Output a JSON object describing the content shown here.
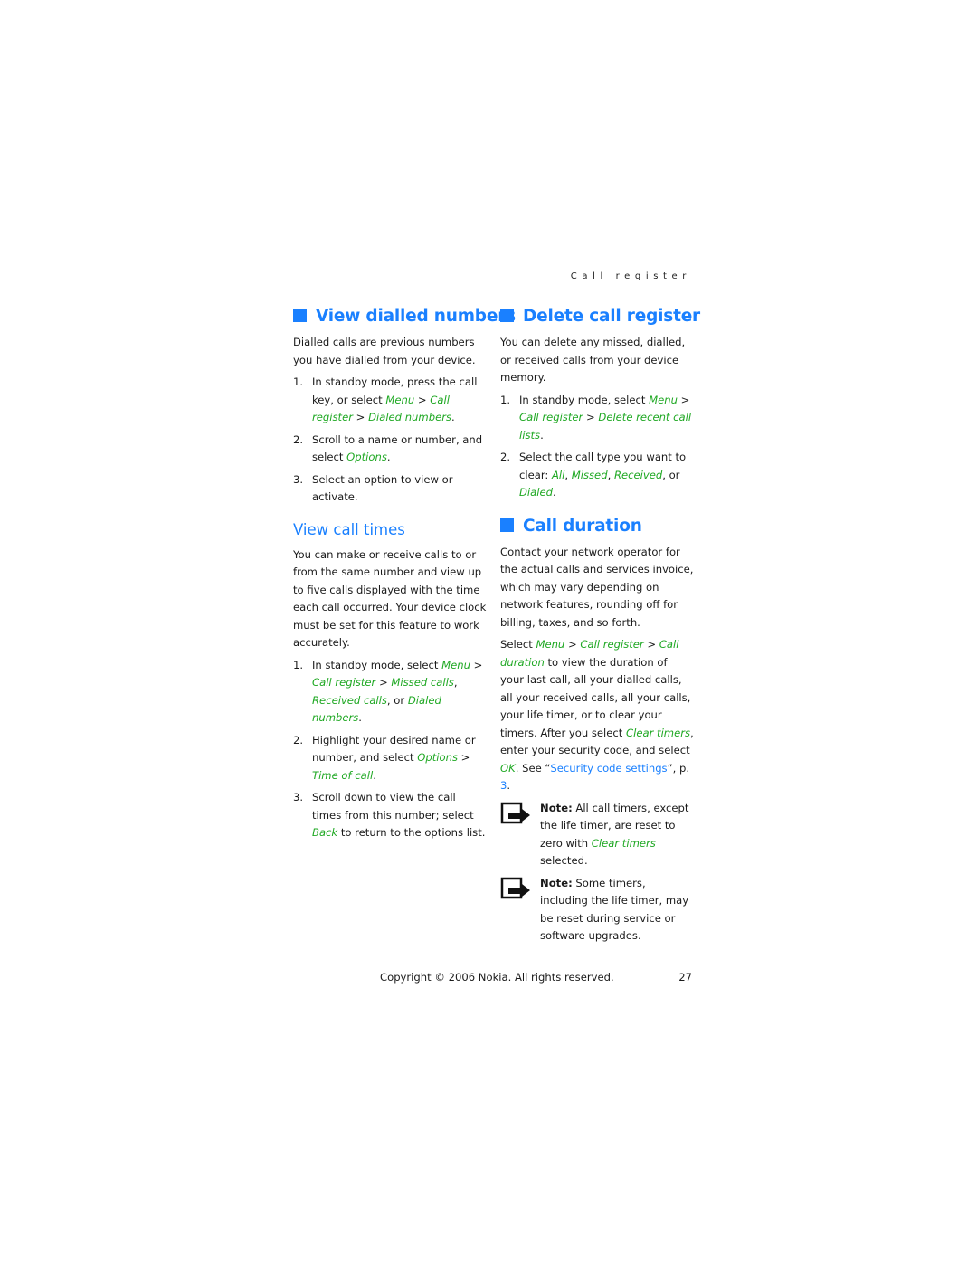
{
  "running_head": "Call register",
  "left_column": {
    "view_dialled": {
      "title": "View dialled numbers",
      "intro": "Dialled calls are previous numbers you have dialled from your device.",
      "steps": [
        {
          "num": "1.",
          "t1": "In standby mode, press the call key, or select ",
          "m1": "Menu",
          "s1": " > ",
          "m2": "Call register",
          "s2": " > ",
          "m3": "Dialed numbers",
          "end": "."
        },
        {
          "num": "2.",
          "t1": "Scroll to a name or number, and select ",
          "m1": "Options",
          "end": "."
        },
        {
          "num": "3.",
          "t1": "Select an option to view or activate."
        }
      ]
    },
    "view_call_times": {
      "title": "View call times",
      "intro": "You can make or receive calls to or from the same number and view up to five calls displayed with the time each call occurred. Your device clock must be set for this feature to work accurately.",
      "steps": [
        {
          "num": "1.",
          "t1": "In standby mode, select ",
          "m1": "Menu",
          "s1": " > ",
          "m2": "Call register",
          "s2": " > ",
          "m3": "Missed calls",
          "s3": ", ",
          "m4": "Received calls",
          "s4": ", or ",
          "m5": "Dialed numbers",
          "end": "."
        },
        {
          "num": "2.",
          "t1": "Highlight your desired name or number, and select ",
          "m1": "Options",
          "s1": " > ",
          "m2": "Time of call",
          "end": "."
        },
        {
          "num": "3.",
          "t1": "Scroll down to view the call times from this number; select ",
          "m1": "Back",
          "end": " to return to the options list."
        }
      ]
    }
  },
  "right_column": {
    "delete_register": {
      "title": "Delete call register",
      "intro": "You can delete any missed, dialled, or received calls from your device memory.",
      "steps": [
        {
          "num": "1.",
          "t1": "In standby mode, select ",
          "m1": "Menu",
          "s1": " > ",
          "m2": "Call register",
          "s2": " > ",
          "m3": "Delete recent call lists",
          "end": "."
        },
        {
          "num": "2.",
          "t1": "Select the call type you want to clear: ",
          "m1": "All",
          "s1": ", ",
          "m2": "Missed",
          "s2": ", ",
          "m3": "Received",
          "s3": ", or ",
          "m4": "Dialed",
          "end": "."
        }
      ]
    },
    "call_duration": {
      "title": "Call duration",
      "intro": "Contact your network operator for the actual calls and services invoice, which may vary depending on network features, rounding off for billing, taxes, and so forth.",
      "p2": {
        "t1": "Select ",
        "m1": "Menu",
        "s1": " > ",
        "m2": "Call register",
        "s2": " > ",
        "m3": "Call duration",
        "t2": " to view the duration of your last call, all your dialled calls, all your received calls, all your calls, your life timer, or to clear your timers. After you select ",
        "m4": "Clear timers",
        "t3": ", enter your security code, and select ",
        "m5": "OK",
        "t4": ". See “",
        "link": "Security code settings",
        "t5": "”, p. ",
        "page_link": "3",
        "t6": "."
      },
      "notes": [
        {
          "label": "Note:",
          "t1": " All call timers, except the life timer, are reset to zero with ",
          "m1": "Clear timers",
          "t2": " selected.",
          "icon": "note-icon"
        },
        {
          "label": "Note:",
          "t1": " Some timers, including the life timer, may be reset during service or software upgrades.",
          "icon": "note-icon"
        }
      ]
    }
  },
  "footer": {
    "copyright": "Copyright © 2006 Nokia. All rights reserved.",
    "page_number": "27"
  },
  "colors": {
    "heading": "#1a80ff",
    "menu_path": "#1fa823",
    "link": "#1a80ff"
  }
}
